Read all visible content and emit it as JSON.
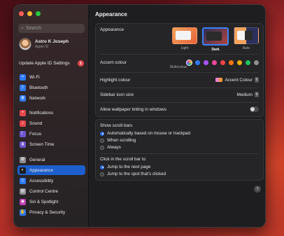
{
  "window": {
    "title": "Appearance"
  },
  "search": {
    "placeholder": "Search"
  },
  "account": {
    "name": "Astro K Joseph",
    "subtitle": "Apple ID"
  },
  "update": {
    "label": "Update Apple ID Settings",
    "badge": "1"
  },
  "sidebar": {
    "items": [
      {
        "label": "Wi-Fi",
        "icon": "wifi-icon",
        "color": "#2f7bf5",
        "glyph": "≈"
      },
      {
        "label": "Bluetooth",
        "icon": "bluetooth-icon",
        "color": "#2f7bf5",
        "glyph": "ᛒ"
      },
      {
        "label": "Network",
        "icon": "globe-icon",
        "color": "#2f7bf5",
        "glyph": "◍"
      },
      {
        "label": "Notifications",
        "icon": "bell-icon",
        "color": "#e5484d",
        "glyph": "•"
      },
      {
        "label": "Sound",
        "icon": "speaker-icon",
        "color": "#e5484d",
        "glyph": "♪"
      },
      {
        "label": "Focus",
        "icon": "moon-icon",
        "color": "#6e56cf",
        "glyph": "☾"
      },
      {
        "label": "Screen Time",
        "icon": "hourglass-icon",
        "color": "#6e56cf",
        "glyph": "⧗"
      },
      {
        "label": "General",
        "icon": "gear-icon",
        "color": "#8e8e93",
        "glyph": "⚙"
      },
      {
        "label": "Appearance",
        "icon": "appearance-icon",
        "color": "#1c1c1e",
        "glyph": "◐",
        "selected": true
      },
      {
        "label": "Accessibility",
        "icon": "accessibility-icon",
        "color": "#2f7bf5",
        "glyph": "☺"
      },
      {
        "label": "Control Centre",
        "icon": "control-centre-icon",
        "color": "#8e8e93",
        "glyph": "▤"
      },
      {
        "label": "Siri & Spotlight",
        "icon": "siri-icon",
        "color": "#c13fb6",
        "glyph": "◉"
      },
      {
        "label": "Privacy & Security",
        "icon": "hand-icon",
        "color": "#2f7bf5",
        "glyph": "✋"
      }
    ]
  },
  "appearance": {
    "label": "Appearance",
    "options": [
      {
        "label": "Light"
      },
      {
        "label": "Dark",
        "selected": true
      },
      {
        "label": "Auto"
      }
    ]
  },
  "accent": {
    "label": "Accent colour",
    "caption": "Multicolour",
    "colors": [
      "multicolour",
      "#2f7bf5",
      "#a855f7",
      "#ec4899",
      "#ef4444",
      "#f97316",
      "#eab308",
      "#22c55e",
      "#8e8e93"
    ]
  },
  "highlight": {
    "label": "Highlight colour",
    "value": "Accent Colour"
  },
  "icon_size": {
    "label": "Sidebar icon size",
    "value": "Medium"
  },
  "tinting": {
    "label": "Allow wallpaper tinting in windows",
    "enabled": false
  },
  "scroll_bars": {
    "title": "Show scroll bars",
    "options": [
      {
        "label": "Automatically based on mouse or trackpad",
        "selected": true
      },
      {
        "label": "When scrolling",
        "selected": false
      },
      {
        "label": "Always",
        "selected": false
      }
    ]
  },
  "click_scroll": {
    "title": "Click in the scroll bar to",
    "options": [
      {
        "label": "Jump to the next page",
        "selected": true
      },
      {
        "label": "Jump to the spot that's clicked",
        "selected": false
      }
    ]
  },
  "help": {
    "label": "?"
  }
}
